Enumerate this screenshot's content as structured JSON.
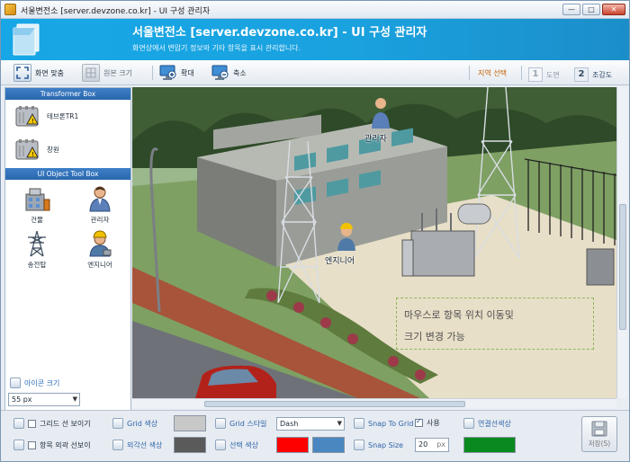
{
  "window": {
    "title": "서울변전소 [server.devzone.co.kr] - UI 구성 관리자",
    "buttons": {
      "minimize": "—",
      "maximize": "□",
      "close": "✕"
    }
  },
  "banner": {
    "title": "서울변전소 [server.devzone.co.kr] - UI 구성 관리자",
    "subtitle": "화면상에서 변압기 정보와 기타 항목을 표시 관리합니다."
  },
  "toolbar": {
    "fit_screen": "화면 맞춤",
    "original_size": "원본 크기",
    "zoom_in": "확대",
    "zoom_out": "축소",
    "region_select": "지역 선택",
    "pages": [
      {
        "number": "1",
        "label": "도면",
        "active": false
      },
      {
        "number": "2",
        "label": "조감도",
        "active": true
      }
    ]
  },
  "left_panel": {
    "transformer_box_title": "Transformer Box",
    "transformer_items": [
      "테브론TR1",
      "창원"
    ],
    "tool_box_title": "UI Object Tool Box",
    "tools": [
      {
        "label": "건물",
        "icon": "building-icon"
      },
      {
        "label": "관리자",
        "icon": "manager-person-icon"
      },
      {
        "label": "송전탑",
        "icon": "transmission-tower-icon"
      },
      {
        "label": "엔지니어",
        "icon": "engineer-person-icon"
      }
    ],
    "icon_size_label": "아이콘 크기",
    "icon_size_value": "55 px"
  },
  "canvas": {
    "overlays": {
      "manager": "관리자",
      "engineer": "엔지니어"
    },
    "hint_line1": "마우스로 항목 위치 이동및",
    "hint_line2": "크기 변경 가능"
  },
  "bottom": {
    "show_grid": "그리드 선 보이기",
    "show_outline": "항목 외곽 선보이",
    "grid_color": "Grid 색상",
    "outline_color": "외각선 색상",
    "grid_style": "Grid 스타일",
    "selection_color": "선택 색상",
    "grid_style_value": "Dash",
    "snap_to_grid": "Snap To Grid",
    "snap_enabled_label": "사용",
    "snap_size": "Snap Size",
    "snap_size_value": "20",
    "snap_size_unit": "px",
    "connector_color": "연결선색상",
    "save": "저장(S)",
    "colors": {
      "grid": "#c8c8c8",
      "outline": "#5a5a5a",
      "selection_red": "#ff0000",
      "selection_blue": "#4a86c0",
      "connector": "#0a8a1e"
    }
  },
  "theme": {
    "accent": "#1aa2df",
    "panel_header": "#2f6fb5"
  }
}
